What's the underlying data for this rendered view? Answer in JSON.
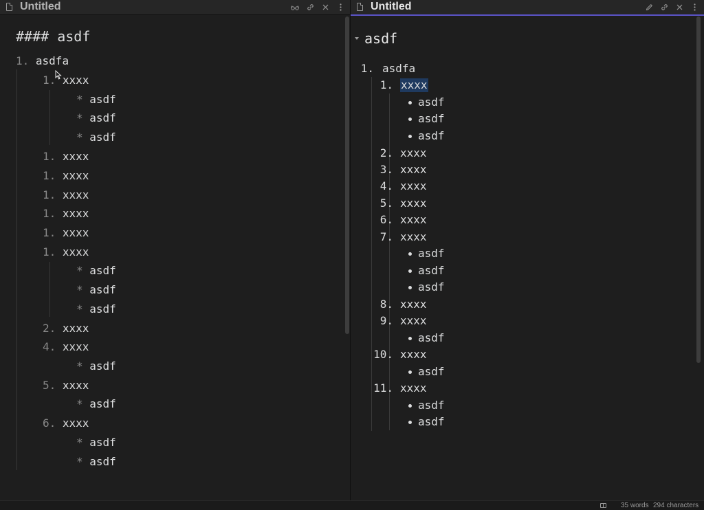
{
  "left_pane": {
    "tab_title": "Untitled",
    "actions": [
      "reading-view-icon",
      "link-icon",
      "close-icon",
      "more-options-icon"
    ],
    "lines": [
      {
        "marker": "",
        "text": "#### asdf"
      },
      {
        "marker": "1.",
        "text": "asdfa"
      },
      {
        "marker": "1.",
        "text": "xxxx"
      },
      {
        "marker": "*",
        "text": "asdf"
      },
      {
        "marker": "*",
        "text": "asdf"
      },
      {
        "marker": "*",
        "text": "asdf"
      },
      {
        "marker": "1.",
        "text": "xxxx"
      },
      {
        "marker": "1.",
        "text": "xxxx"
      },
      {
        "marker": "1.",
        "text": "xxxx"
      },
      {
        "marker": "1.",
        "text": "xxxx"
      },
      {
        "marker": "1.",
        "text": "xxxx"
      },
      {
        "marker": "1.",
        "text": "xxxx"
      },
      {
        "marker": "*",
        "text": "asdf"
      },
      {
        "marker": "*",
        "text": "asdf"
      },
      {
        "marker": "*",
        "text": "asdf"
      },
      {
        "marker": "2.",
        "text": "xxxx"
      },
      {
        "marker": "4.",
        "text": "xxxx"
      },
      {
        "marker": "*",
        "text": "asdf"
      },
      {
        "marker": "5.",
        "text": "xxxx"
      },
      {
        "marker": "*",
        "text": "asdf"
      },
      {
        "marker": "6.",
        "text": "xxxx"
      },
      {
        "marker": "*",
        "text": "asdf"
      },
      {
        "marker": "*",
        "text": "asdf"
      }
    ]
  },
  "right_pane": {
    "tab_title": "Untitled",
    "actions": [
      "edit-icon",
      "link-icon",
      "close-icon",
      "more-options-icon"
    ],
    "heading": "asdf",
    "items": [
      {
        "kind": "num",
        "num": "1.",
        "text": "asdfa"
      },
      {
        "kind": "num",
        "num": "1.",
        "text": "xxxx"
      },
      {
        "kind": "bullet",
        "text": "asdf"
      },
      {
        "kind": "bullet",
        "text": "asdf"
      },
      {
        "kind": "bullet",
        "text": "asdf"
      },
      {
        "kind": "num",
        "num": "2.",
        "text": "xxxx"
      },
      {
        "kind": "num",
        "num": "3.",
        "text": "xxxx"
      },
      {
        "kind": "num",
        "num": "4.",
        "text": "xxxx"
      },
      {
        "kind": "num",
        "num": "5.",
        "text": "xxxx"
      },
      {
        "kind": "num",
        "num": "6.",
        "text": "xxxx"
      },
      {
        "kind": "num",
        "num": "7.",
        "text": "xxxx"
      },
      {
        "kind": "bullet",
        "text": "asdf"
      },
      {
        "kind": "bullet",
        "text": "asdf"
      },
      {
        "kind": "bullet",
        "text": "asdf"
      },
      {
        "kind": "num",
        "num": "8.",
        "text": "xxxx"
      },
      {
        "kind": "num",
        "num": "9.",
        "text": "xxxx"
      },
      {
        "kind": "bullet",
        "text": "asdf"
      },
      {
        "kind": "num",
        "num": "10.",
        "text": "xxxx"
      },
      {
        "kind": "bullet",
        "text": "asdf"
      },
      {
        "kind": "num",
        "num": "11.",
        "text": "xxxx"
      },
      {
        "kind": "bullet",
        "text": "asdf"
      },
      {
        "kind": "bullet",
        "text": "asdf"
      }
    ]
  },
  "status_bar": {
    "words": "35 words",
    "characters": "294 characters"
  },
  "colors": {
    "background": "#1e1e1e",
    "active_tab_accent": "#5b54c8",
    "selection": "#1f3a5f"
  }
}
